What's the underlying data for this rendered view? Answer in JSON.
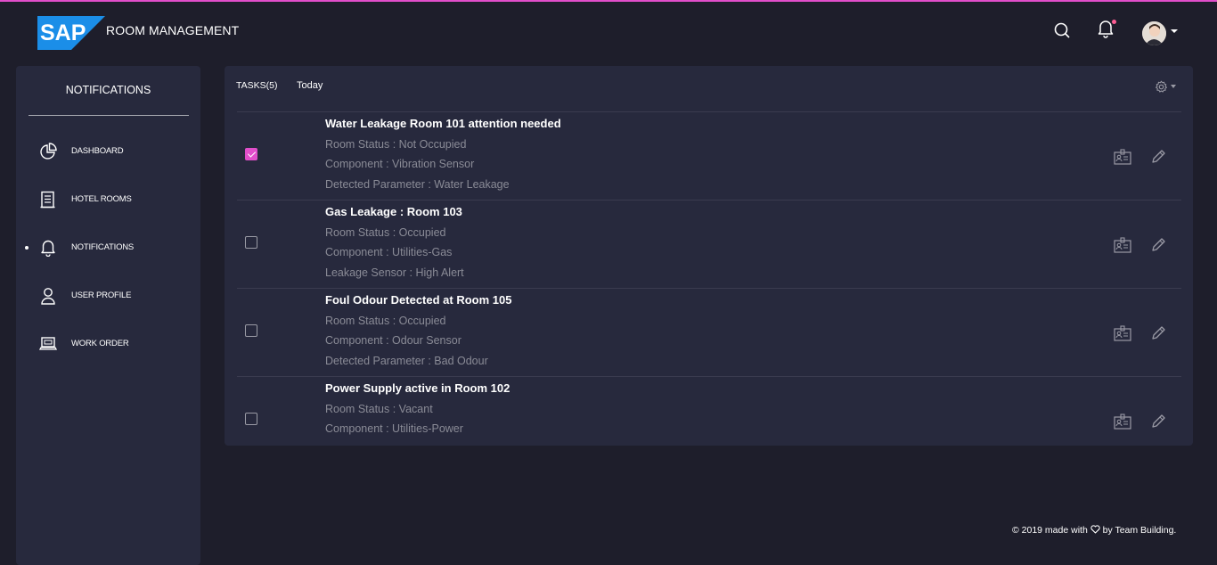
{
  "header": {
    "brand": "SAP",
    "app_title": "ROOM MANAGEMENT",
    "icons": [
      "search-icon",
      "bell-icon",
      "avatar",
      "caret-down-icon"
    ],
    "accent_color": "#e14eca",
    "brand_color": "#1b8ee8"
  },
  "sidebar": {
    "title": "NOTIFICATIONS",
    "items": [
      {
        "label": "DASHBOARD",
        "icon": "pie-chart-icon",
        "active": false
      },
      {
        "label": "HOTEL ROOMS",
        "icon": "list-icon",
        "active": false
      },
      {
        "label": "NOTIFICATIONS",
        "icon": "bell-icon",
        "active": true
      },
      {
        "label": "USER PROFILE",
        "icon": "user-icon",
        "active": false
      },
      {
        "label": "WORK ORDER",
        "icon": "laptop-icon",
        "active": false
      }
    ]
  },
  "tasks_card": {
    "tasks_label": "TASKS(5)",
    "today_label": "Today",
    "tasks": [
      {
        "title": "Water Leakage Room 101 attention needed",
        "lines": [
          "Room Status : Not Occupied",
          "Component : Vibration Sensor",
          "Detected Parameter : Water Leakage"
        ],
        "checked": true
      },
      {
        "title": "Gas Leakage : Room 103",
        "lines": [
          "Room Status : Occupied",
          "Component : Utilities-Gas",
          "Leakage Sensor : High Alert"
        ],
        "checked": false
      },
      {
        "title": "Foul Odour Detected at Room 105",
        "lines": [
          "Room Status : Occupied",
          "Component : Odour Sensor",
          "Detected Parameter : Bad Odour"
        ],
        "checked": false
      },
      {
        "title": "Power Supply active in Room 102",
        "lines": [
          "Room Status : Vacant",
          "Component : Utilities-Power"
        ],
        "checked": false
      }
    ]
  },
  "footer": {
    "prefix": "© 2019 made with",
    "suffix": "by Team Building."
  }
}
